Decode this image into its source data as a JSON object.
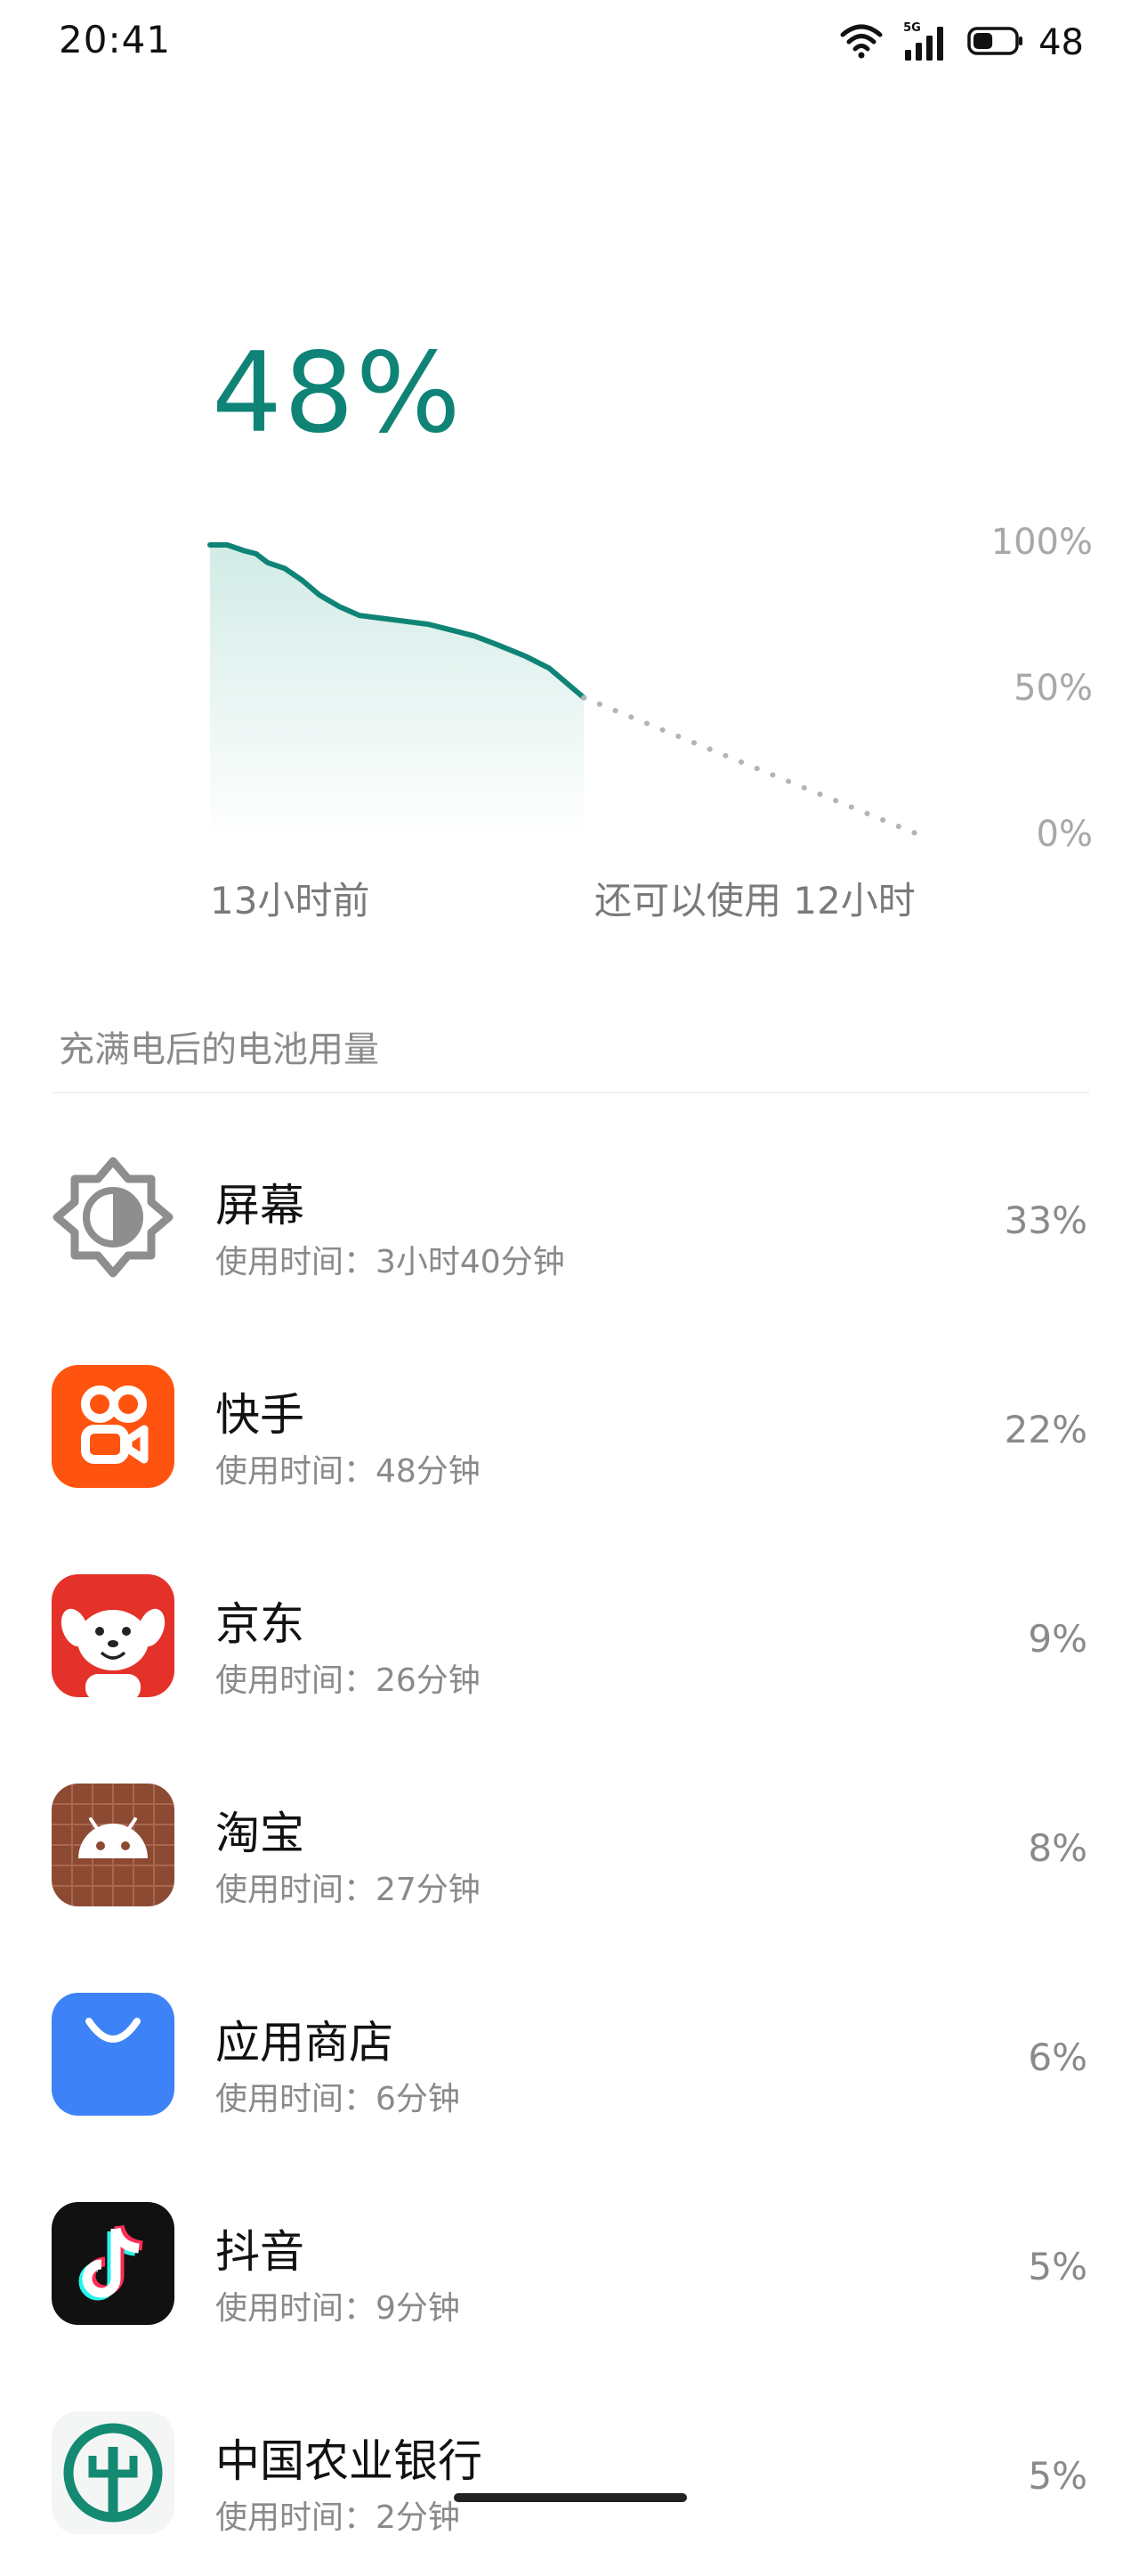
{
  "status_bar": {
    "time": "20:41",
    "network_label": "5G",
    "battery_level_text": "48",
    "battery_fill": 0.48
  },
  "battery": {
    "percent_text": "48%"
  },
  "chart_data": {
    "type": "area",
    "y_tick_labels": [
      "100%",
      "50%",
      "0%"
    ],
    "ylim": [
      0,
      100
    ],
    "x_start_label": "13小时前",
    "x_end_label": "还可以使用 12小时",
    "series": [
      {
        "style": "solid",
        "hours_from_start": [
          0,
          0.6,
          1.2,
          1.6,
          2.0,
          2.6,
          3.2,
          3.8,
          4.5,
          5.2,
          6.0,
          6.8,
          7.6,
          8.4,
          9.2,
          10.0,
          11.0,
          11.8,
          12.4,
          13.0
        ],
        "values": [
          100,
          100,
          98,
          97,
          94,
          92,
          88,
          83,
          79,
          76,
          75,
          74,
          73,
          71,
          69,
          66,
          62,
          58,
          53,
          48
        ]
      },
      {
        "style": "dotted",
        "hours_from_start": [
          13,
          25
        ],
        "values": [
          48,
          0
        ]
      }
    ],
    "colors": {
      "line": "#0f8476",
      "fill_top": "#cde9e3",
      "dotted": "#b0b6b5"
    }
  },
  "section": {
    "title": "充满电后的电池用量"
  },
  "apps": [
    {
      "icon": "brightness-icon",
      "name": "屏幕",
      "usage": "使用时间：3小时40分钟",
      "percent": "33%"
    },
    {
      "icon": "kuaishou-icon",
      "name": "快手",
      "usage": "使用时间：48分钟",
      "percent": "22%"
    },
    {
      "icon": "jd-icon",
      "name": "京东",
      "usage": "使用时间：26分钟",
      "percent": "9%"
    },
    {
      "icon": "taobao-android-icon",
      "name": "淘宝",
      "usage": "使用时间：27分钟",
      "percent": "8%"
    },
    {
      "icon": "app-store-icon",
      "name": "应用商店",
      "usage": "使用时间：6分钟",
      "percent": "6%"
    },
    {
      "icon": "douyin-icon",
      "name": "抖音",
      "usage": "使用时间：9分钟",
      "percent": "5%"
    },
    {
      "icon": "abc-bank-icon",
      "name": "中国农业银行",
      "usage": "使用时间：2分钟",
      "percent": "5%"
    }
  ],
  "colors": {
    "accent": "#0f8476",
    "kuaishou": "#ff5310",
    "jd": "#e4322a",
    "taobao": "#8c4a33",
    "app_store": "#3d82f7",
    "douyin": "#111111",
    "abc_bank": "#138a71"
  }
}
